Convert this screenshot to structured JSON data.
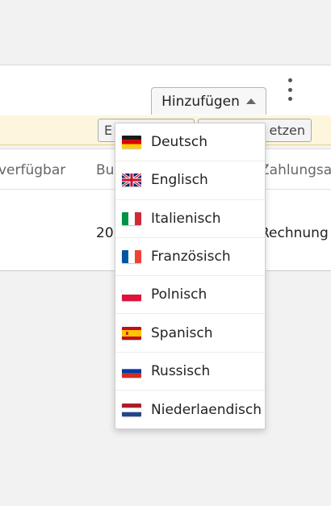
{
  "toolbar": {
    "add_label": "Hinzufügen"
  },
  "warning_bar": {
    "left_button_label": "E",
    "right_button_label": "etzen"
  },
  "table": {
    "headers": [
      "verfügbar",
      "Bu",
      "Zahlungsa"
    ],
    "row": [
      "20",
      "Rechnung"
    ]
  },
  "language_menu": {
    "items": [
      {
        "label": "Deutsch",
        "flag": "flag-de"
      },
      {
        "label": "Englisch",
        "flag": "flag-gb"
      },
      {
        "label": "Italienisch",
        "flag": "flag-it"
      },
      {
        "label": "Französisch",
        "flag": "flag-fr"
      },
      {
        "label": "Polnisch",
        "flag": "flag-pl"
      },
      {
        "label": "Spanisch",
        "flag": "flag-es"
      },
      {
        "label": "Russisch",
        "flag": "flag-ru"
      },
      {
        "label": "Niederlaendisch",
        "flag": "flag-nl"
      }
    ]
  },
  "colors": {
    "warning_background": "#fdf6dd",
    "menu_background": "#ffffff"
  }
}
